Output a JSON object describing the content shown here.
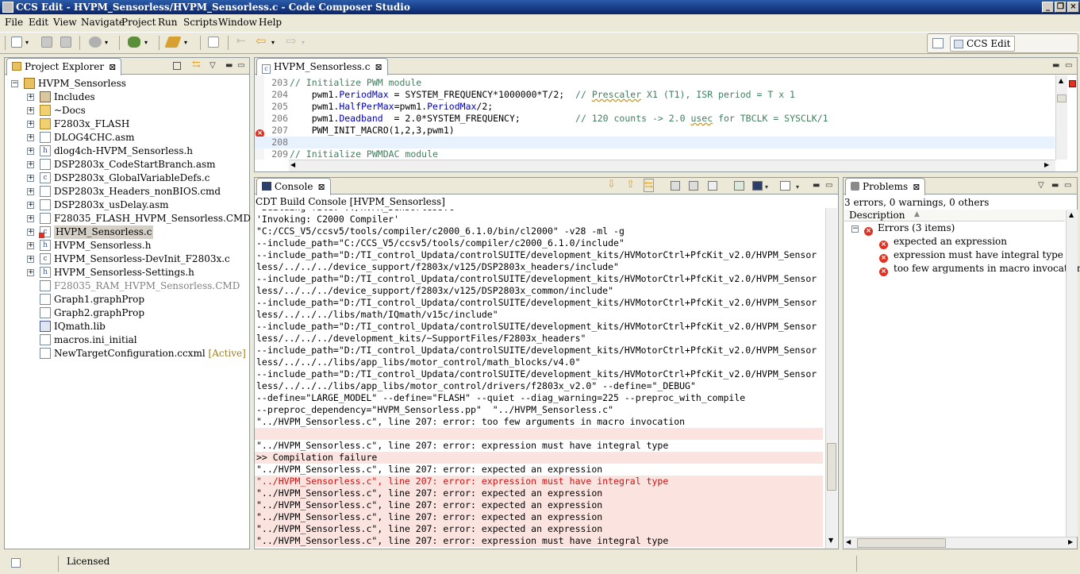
{
  "window": {
    "title": "CCS Edit - HVPM_Sensorless/HVPM_Sensorless.c - Code Composer Studio"
  },
  "menu": [
    "File",
    "Edit",
    "View",
    "Navigate",
    "Project",
    "Run",
    "Scripts",
    "Window",
    "Help"
  ],
  "perspective": {
    "label": "CCS Edit"
  },
  "project_explorer": {
    "tab_label": "Project Explorer",
    "items": [
      {
        "label": "HVPM_Sensorless",
        "icon": "project-icon",
        "level": 0,
        "expander": "minus"
      },
      {
        "label": "Includes",
        "icon": "includes-icon",
        "level": 1,
        "expander": "plus"
      },
      {
        "label": "~Docs",
        "icon": "folder-icon",
        "level": 1,
        "expander": "plus"
      },
      {
        "label": "F2803x_FLASH",
        "icon": "folder-icon",
        "level": 1,
        "expander": "plus"
      },
      {
        "label": "DLOG4CHC.asm",
        "icon": "asm-file-icon",
        "level": 1,
        "expander": "plus"
      },
      {
        "label": "dlog4ch-HVPM_Sensorless.h",
        "icon": "header-file-icon",
        "level": 1,
        "expander": "plus"
      },
      {
        "label": "DSP2803x_CodeStartBranch.asm",
        "icon": "asm-file-icon",
        "level": 1,
        "expander": "plus"
      },
      {
        "label": "DSP2803x_GlobalVariableDefs.c",
        "icon": "c-file-icon",
        "level": 1,
        "expander": "plus"
      },
      {
        "label": "DSP2803x_Headers_nonBIOS.cmd",
        "icon": "cmd-file-icon",
        "level": 1,
        "expander": "plus"
      },
      {
        "label": "DSP2803x_usDelay.asm",
        "icon": "asm-file-icon",
        "level": 1,
        "expander": "plus"
      },
      {
        "label": "F28035_FLASH_HVPM_Sensorless.CMD",
        "icon": "cmd-file-icon",
        "level": 1,
        "expander": "plus"
      },
      {
        "label": "HVPM_Sensorless.c",
        "icon": "c-file-error-icon",
        "level": 1,
        "expander": "plus",
        "selected": true
      },
      {
        "label": "HVPM_Sensorless.h",
        "icon": "header-file-icon",
        "level": 1,
        "expander": "plus"
      },
      {
        "label": "HVPM_Sensorless-DevInit_F2803x.c",
        "icon": "c-file-icon",
        "level": 1,
        "expander": "plus"
      },
      {
        "label": "HVPM_Sensorless-Settings.h",
        "icon": "header-file-icon",
        "level": 1,
        "expander": "plus"
      },
      {
        "label": "F28035_RAM_HVPM_Sensorless.CMD",
        "icon": "cmd-file-icon",
        "level": 1,
        "expander": "none",
        "dimmed": true
      },
      {
        "label": "Graph1.graphProp",
        "icon": "file-icon",
        "level": 1,
        "expander": "none"
      },
      {
        "label": "Graph2.graphProp",
        "icon": "file-icon",
        "level": 1,
        "expander": "none"
      },
      {
        "label": "IQmath.lib",
        "icon": "lib-file-icon",
        "level": 1,
        "expander": "none"
      },
      {
        "label": "macros.ini_initial",
        "icon": "file-icon",
        "level": 1,
        "expander": "none"
      },
      {
        "label": "NewTargetConfiguration.ccxml",
        "icon": "ccxml-file-icon",
        "level": 1,
        "expander": "none",
        "suffix": "[Active]"
      }
    ]
  },
  "editor": {
    "tab_label": "HVPM_Sensorless.c",
    "lines": [
      {
        "num": "203",
        "parts": [
          {
            "t": "// Initialize PWM module",
            "c": "cm"
          }
        ]
      },
      {
        "num": "204",
        "parts": [
          {
            "t": "    pwm1.",
            "c": ""
          },
          {
            "t": "PeriodMax",
            "c": "fld"
          },
          {
            "t": " = SYSTEM_FREQUENCY*1000000*T/2;  ",
            "c": ""
          },
          {
            "t": "// Prescaler X1 (T1), ISR period = T x 1",
            "c": "cm"
          }
        ]
      },
      {
        "num": "205",
        "parts": [
          {
            "t": "    pwm1.",
            "c": ""
          },
          {
            "t": "HalfPerMax",
            "c": "fld"
          },
          {
            "t": "=pwm1.",
            "c": ""
          },
          {
            "t": "PeriodMax",
            "c": "fld"
          },
          {
            "t": "/2;",
            "c": ""
          }
        ]
      },
      {
        "num": "206",
        "parts": [
          {
            "t": "    pwm1.",
            "c": ""
          },
          {
            "t": "Deadband",
            "c": "fld"
          },
          {
            "t": "  = 2.0*SYSTEM_FREQUENCY;          ",
            "c": ""
          },
          {
            "t": "// 120 counts -> 2.0 usec for TBCLK = SYSCLK/1",
            "c": "cm"
          }
        ]
      },
      {
        "num": "207",
        "parts": [
          {
            "t": "    PWM_INIT_MACRO(1,2,3,pwm1)",
            "c": ""
          }
        ],
        "error": true
      },
      {
        "num": "208",
        "parts": [
          {
            "t": "",
            "c": ""
          }
        ],
        "current": true
      },
      {
        "num": "209",
        "parts": [
          {
            "t": "// Initialize PWMDAC module",
            "c": "cm"
          }
        ]
      }
    ]
  },
  "console": {
    "tab_label": "Console",
    "subtitle": "CDT Build Console [HVPM_Sensorless]",
    "lines": [
      {
        "t": "'Building file: ../HVPM_Sensorless.c'"
      },
      {
        "t": "'Invoking: C2000 Compiler'"
      },
      {
        "t": "\"C:/CCS_V5/ccsv5/tools/compiler/c2000_6.1.0/bin/cl2000\" -v28 -ml -g"
      },
      {
        "t": "--include_path=\"C:/CCS_V5/ccsv5/tools/compiler/c2000_6.1.0/include\""
      },
      {
        "t": "--include_path=\"D:/TI_control_Updata/controlSUITE/development_kits/HVMotorCtrl+PfcKit_v2.0/HVPM_Sensor"
      },
      {
        "t": "less/../../../device_support/f2803x/v125/DSP2803x_headers/include\""
      },
      {
        "t": "--include_path=\"D:/TI_control_Updata/controlSUITE/development_kits/HVMotorCtrl+PfcKit_v2.0/HVPM_Sensor"
      },
      {
        "t": "less/../../../device_support/f2803x/v125/DSP2803x_common/include\""
      },
      {
        "t": "--include_path=\"D:/TI_control_Updata/controlSUITE/development_kits/HVMotorCtrl+PfcKit_v2.0/HVPM_Sensor"
      },
      {
        "t": "less/../../../libs/math/IQmath/v15c/include\""
      },
      {
        "t": "--include_path=\"D:/TI_control_Updata/controlSUITE/development_kits/HVMotorCtrl+PfcKit_v2.0/HVPM_Sensor"
      },
      {
        "t": "less/../../../development_kits/~SupportFiles/F2803x_headers\""
      },
      {
        "t": "--include_path=\"D:/TI_control_Updata/controlSUITE/development_kits/HVMotorCtrl+PfcKit_v2.0/HVPM_Sensor"
      },
      {
        "t": "less/../../../libs/app_libs/motor_control/math_blocks/v4.0\""
      },
      {
        "t": "--include_path=\"D:/TI_control_Updata/controlSUITE/development_kits/HVMotorCtrl+PfcKit_v2.0/HVPM_Sensor"
      },
      {
        "t": "less/../../../libs/app_libs/motor_control/drivers/f2803x_v2.0\" --define=\"_DEBUG\""
      },
      {
        "t": "--define=\"LARGE_MODEL\" --define=\"FLASH\" --quiet --diag_warning=225 --preproc_with_compile"
      },
      {
        "t": "--preproc_dependency=\"HVPM_Sensorless.pp\"  \"../HVPM_Sensorless.c\""
      },
      {
        "t": "\"../HVPM_Sensorless.c\", line 207: error: too few arguments in macro invocation"
      },
      {
        "t": "",
        "bg": true
      },
      {
        "t": "\"../HVPM_Sensorless.c\", line 207: error: expression must have integral type"
      },
      {
        "t": ">> Compilation failure",
        "bg": true
      },
      {
        "t": "\"../HVPM_Sensorless.c\", line 207: error: expected an expression"
      },
      {
        "t": "\"../HVPM_Sensorless.c\", line 207: error: expression must have integral type",
        "bg": true,
        "red": true
      },
      {
        "t": "\"../HVPM_Sensorless.c\", line 207: error: expected an expression",
        "bg": true
      },
      {
        "t": "\"../HVPM_Sensorless.c\", line 207: error: expected an expression",
        "bg": true
      },
      {
        "t": "\"../HVPM_Sensorless.c\", line 207: error: expected an expression",
        "bg": true
      },
      {
        "t": "\"../HVPM_Sensorless.c\", line 207: error: expected an expression",
        "bg": true
      },
      {
        "t": "\"../HVPM_Sensorless.c\", line 207: error: expression must have integral type",
        "bg": true
      }
    ]
  },
  "problems": {
    "tab_label": "Problems",
    "summary": "3 errors, 0 warnings, 0 others",
    "column": "Description",
    "group": "Errors (3 items)",
    "items": [
      "expected an expression",
      "expression must have integral type",
      "too few arguments in macro invocation"
    ]
  },
  "status": {
    "license": "Licensed"
  },
  "colors": {
    "title_bar": "#0a246a",
    "error": "#e03020",
    "error_line_bg": "#fbe3df",
    "comment": "#3f7f5f",
    "field": "#0000c0"
  }
}
